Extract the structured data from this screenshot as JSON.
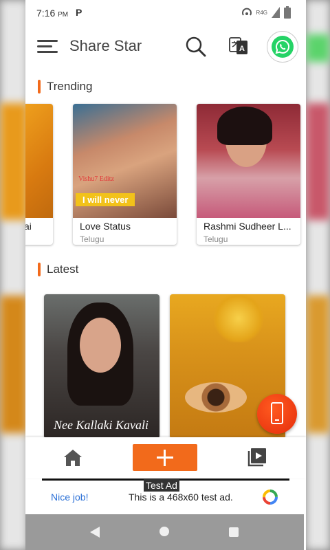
{
  "status_bar": {
    "time": "7:16",
    "ampm": "PM",
    "carrier_glyph": "P",
    "network": "R4G"
  },
  "app": {
    "title": "Share Star"
  },
  "sections": {
    "trending": "Trending",
    "latest": "Latest"
  },
  "trending_cards": [
    {
      "name": "ai",
      "lang": ""
    },
    {
      "name": "Love Status",
      "lang": "Telugu",
      "overlay_text": "I will never",
      "watermark": "Vishu7 Editz"
    },
    {
      "name": "Rashmi Sudheer L...",
      "lang": "Telugu"
    }
  ],
  "latest_cards": [
    {
      "caption": "Nee Kallaki Kavali"
    },
    {
      "caption": ""
    }
  ],
  "ad": {
    "label": "Test Ad",
    "nice": "Nice job!",
    "text": "This is a 468x60 test ad."
  },
  "icons": {
    "menu": "menu-icon",
    "search": "search-icon",
    "translate": "translate-icon",
    "whatsapp": "whatsapp-icon",
    "fab": "phone-icon",
    "home": "home-icon",
    "add": "plus-icon",
    "video": "video-library-icon"
  },
  "colors": {
    "accent": "#f26a1b",
    "whatsapp": "#25d366",
    "fab": "#e52d0c"
  }
}
